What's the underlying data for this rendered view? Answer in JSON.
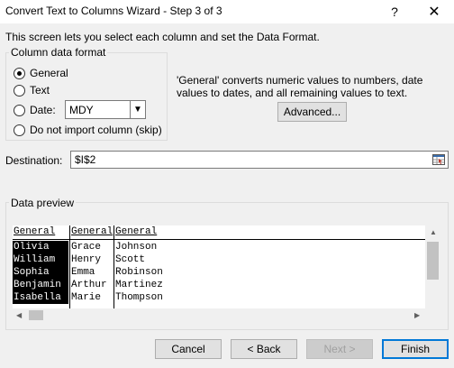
{
  "window": {
    "title": "Convert Text to Columns Wizard - Step 3 of 3",
    "help_glyph": "?",
    "close_glyph": "✕"
  },
  "intro": "This screen lets you select each column and set the Data Format.",
  "column_format": {
    "legend": "Column data format",
    "options": [
      {
        "label": "General",
        "checked": true
      },
      {
        "label": "Text",
        "checked": false
      },
      {
        "label": "Date:",
        "checked": false
      },
      {
        "label": "Do not import column (skip)",
        "checked": false
      }
    ],
    "date_value": "MDY"
  },
  "info_text": "'General' converts numeric values to numbers, date values to dates, and all remaining values to text.",
  "advanced_label": "Advanced...",
  "destination": {
    "label": "Destination:",
    "value": "$I$2"
  },
  "preview": {
    "legend": "Data preview",
    "headers": [
      "General",
      "General",
      "General"
    ],
    "rows": [
      [
        "Olivia",
        "Grace",
        "Johnson"
      ],
      [
        "William",
        "Henry",
        "Scott"
      ],
      [
        "Sophia",
        "Emma",
        "Robinson"
      ],
      [
        "Benjamin",
        "Arthur",
        "Martinez"
      ],
      [
        "Isabella",
        "Marie",
        "Thompson"
      ]
    ]
  },
  "buttons": {
    "cancel": "Cancel",
    "back": "< Back",
    "next": "Next >",
    "finish": "Finish"
  },
  "colors": {
    "accent": "#0078d7",
    "selection": "#000000"
  }
}
